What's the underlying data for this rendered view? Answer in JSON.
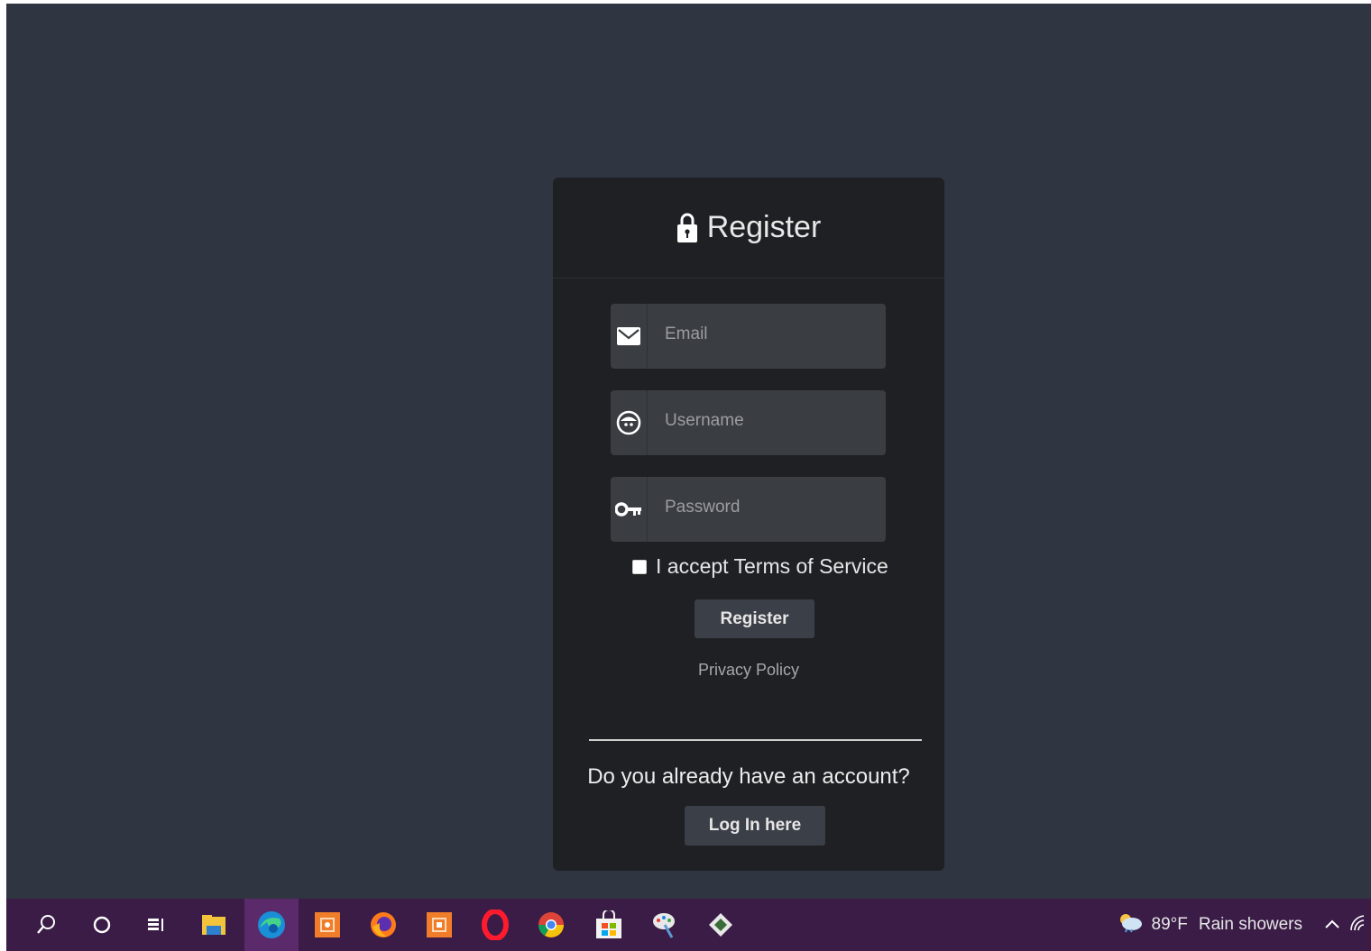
{
  "card": {
    "title": "Register",
    "fields": {
      "email": {
        "placeholder": "Email",
        "icon": "envelope-icon"
      },
      "username": {
        "placeholder": "Username",
        "icon": "user-face-icon"
      },
      "password": {
        "placeholder": "Password",
        "icon": "key-icon"
      }
    },
    "terms_label": "I accept Terms of Service",
    "register_button": "Register",
    "privacy_link": "Privacy Policy",
    "already_text": "Do you already have an account?",
    "login_button": "Log In here"
  },
  "taskbar": {
    "weather_temp": "89°F",
    "weather_text": "Rain showers"
  },
  "colors": {
    "background": "#2f3541",
    "card": "#1f2023",
    "field": "#3a3d42",
    "button": "#3b3f47",
    "taskbar": "#3a1c47"
  }
}
